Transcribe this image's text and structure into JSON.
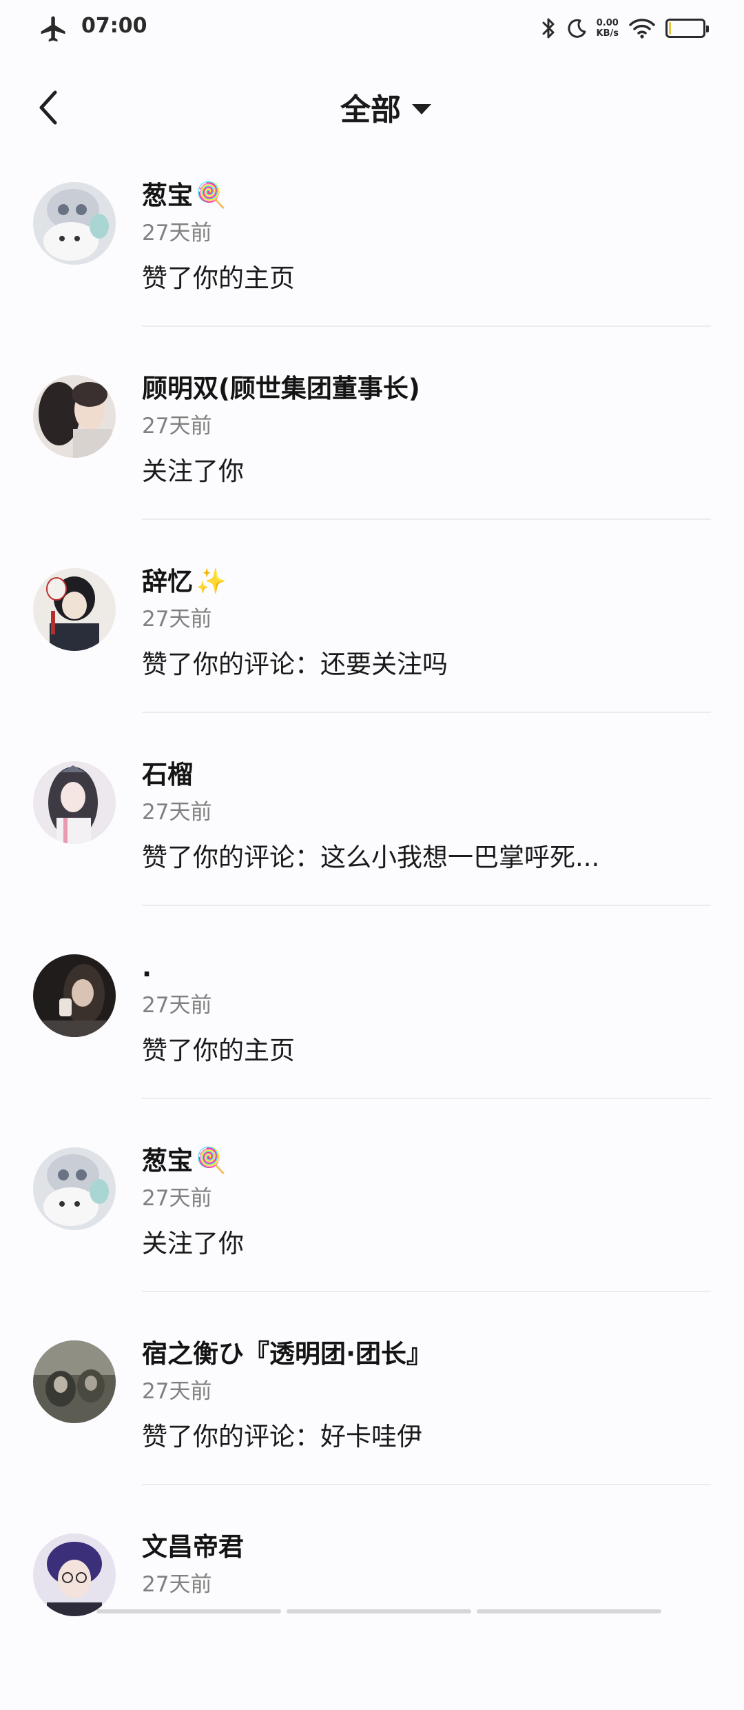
{
  "status_bar": {
    "time": "07:00",
    "net_speed_value": "0.00",
    "net_speed_unit": "KB/s",
    "battery_level": 0.05
  },
  "header": {
    "title": "全部"
  },
  "notifications": [
    {
      "name": "葱宝",
      "emoji": "🍭",
      "time": "27天前",
      "action": "赞了你的主页"
    },
    {
      "name": "顾明双(顾世集团董事长)",
      "emoji": "",
      "time": "27天前",
      "action": "关注了你"
    },
    {
      "name": "辞忆",
      "emoji": "✨",
      "time": "27天前",
      "action": "赞了你的评论：还要关注吗"
    },
    {
      "name": "石榴",
      "emoji": "",
      "time": "27天前",
      "action": "赞了你的评论：这么小我想一巴掌呼死..."
    },
    {
      "name": ".",
      "emoji": "",
      "time": "27天前",
      "action": "赞了你的主页"
    },
    {
      "name": "葱宝",
      "emoji": "🍭",
      "time": "27天前",
      "action": "关注了你"
    },
    {
      "name": "宿之衡ひ『透明团·团长』",
      "emoji": "",
      "time": "27天前",
      "action": "赞了你的评论：好卡哇伊"
    },
    {
      "name": "文昌帝君",
      "emoji": "",
      "time": "27天前",
      "action": ""
    }
  ]
}
